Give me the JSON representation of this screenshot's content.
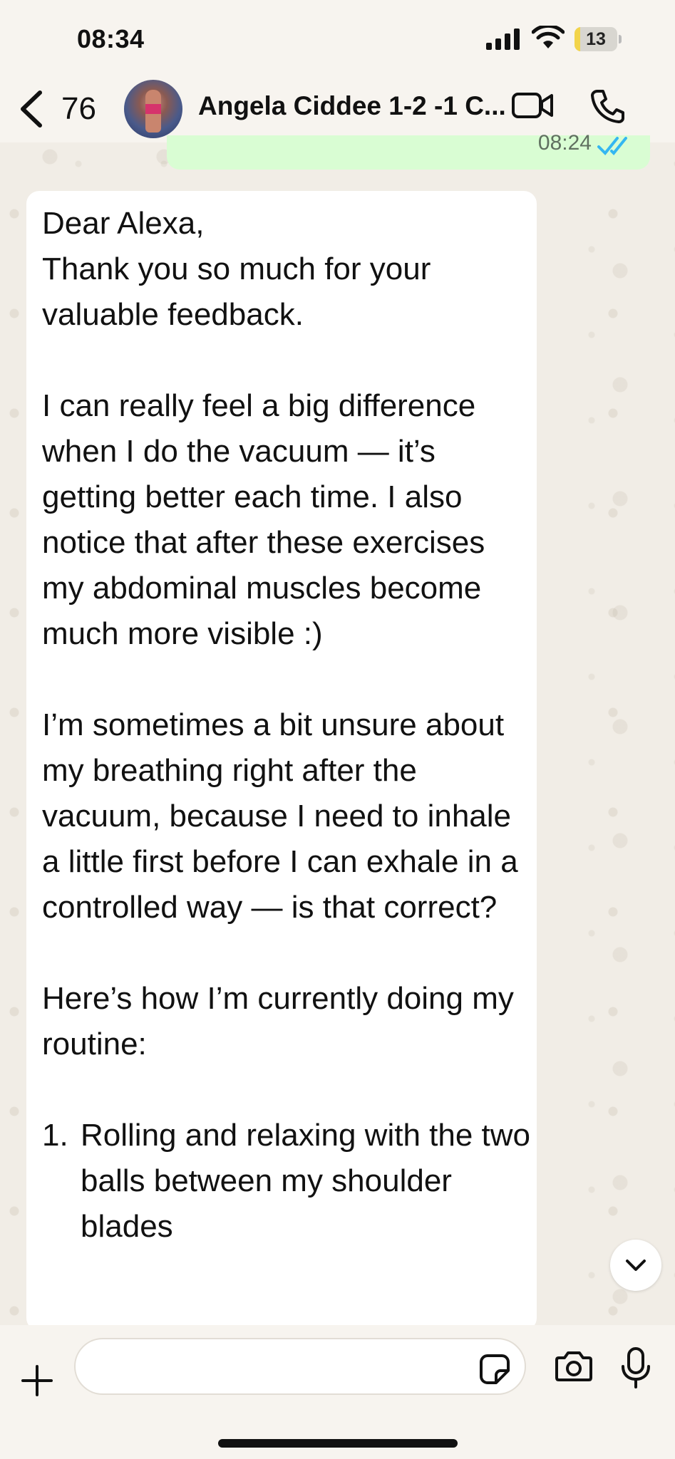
{
  "status_bar": {
    "time": "08:34",
    "battery_level": "13",
    "battery_fraction": 0.13,
    "icons": [
      "signal-icon",
      "wifi-icon",
      "battery-icon"
    ]
  },
  "header": {
    "back_count": "76",
    "contact_name": "Angela Ciddee 1-2 -1 C...",
    "icons": [
      "back-chevron-icon",
      "video-call-icon",
      "voice-call-icon"
    ]
  },
  "outgoing_message": {
    "time": "08:24",
    "status_icon": "double-check-read-icon"
  },
  "incoming_message": {
    "greeting": "Dear Alexa,",
    "p1": "Thank you so much for your valuable feedback.",
    "p2": "I can really feel a big difference when I do the vacuum — it’s getting better each time. I also notice that after these exercises my abdominal muscles become much more visible :)",
    "p3": "I’m sometimes a bit unsure about my breathing right after the vacuum, because I need to inhale a little first before I can exhale in a controlled way — is that correct?",
    "p4": "Here’s how I’m currently doing my routine:",
    "list": [
      {
        "number": "1.",
        "text": "Rolling and relaxing with the two balls between my shoulder blades"
      }
    ]
  },
  "composer": {
    "placeholder": "",
    "icons": [
      "plus-icon",
      "sticker-icon",
      "camera-icon",
      "microphone-icon"
    ]
  },
  "colors": {
    "outgoing_bubble": "#d9fdd3",
    "incoming_bubble": "#ffffff",
    "read_receipt": "#34b7f1",
    "battery_fill": "#f2d44a"
  }
}
